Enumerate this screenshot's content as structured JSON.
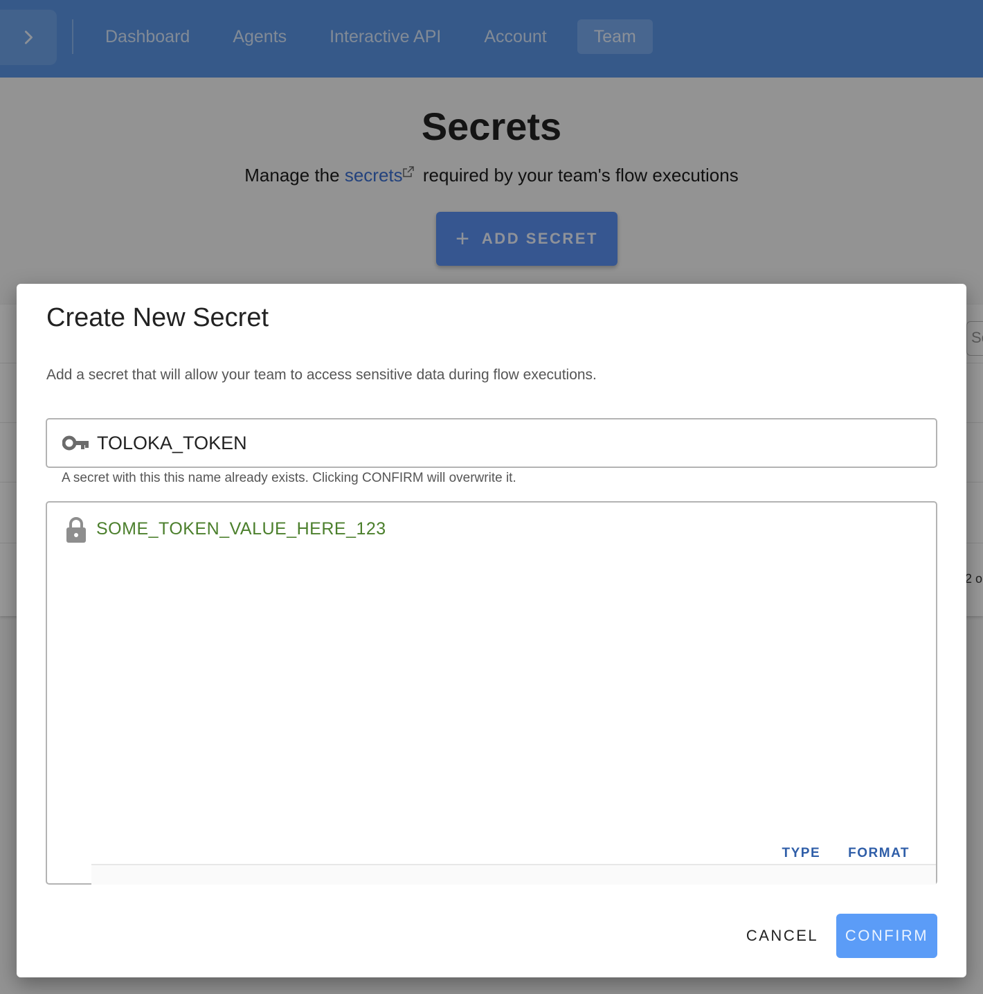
{
  "nav": {
    "items": [
      {
        "label": "Dashboard",
        "active": false
      },
      {
        "label": "Agents",
        "active": false
      },
      {
        "label": "Interactive API",
        "active": false
      },
      {
        "label": "Account",
        "active": false
      },
      {
        "label": "Team",
        "active": true
      }
    ],
    "toggle_icon": "chevron-right-icon"
  },
  "page": {
    "title": "Secrets",
    "subtitle_prefix": "Manage the ",
    "subtitle_link": "secrets",
    "subtitle_suffix": " required by your team's flow executions",
    "link_icon": "external-link-icon",
    "add_button_label": "ADD SECRET",
    "add_button_icon": "plus-icon",
    "search_fragment": "Se",
    "pagination_fragment": "2 o"
  },
  "dialog": {
    "title": "Create New Secret",
    "description": "Add a secret that will allow your team to access sensitive data during flow executions.",
    "name_field": {
      "value": "TOLOKA_TOKEN",
      "icon": "key-icon",
      "helper_text": "A secret with this this name already exists. Clicking CONFIRM will overwrite it."
    },
    "value_field": {
      "value": "SOME_TOKEN_VALUE_HERE_123",
      "icon": "lock-icon",
      "type_label": "TYPE",
      "format_label": "FORMAT"
    },
    "cancel_label": "CANCEL",
    "confirm_label": "CONFIRM"
  },
  "colors": {
    "topbar": "#5b95e4",
    "primary_button": "#5b9cf7",
    "link": "#3b6fd0",
    "secret_value": "#4b7f2c",
    "toolbar_text": "#2f5ea8"
  }
}
